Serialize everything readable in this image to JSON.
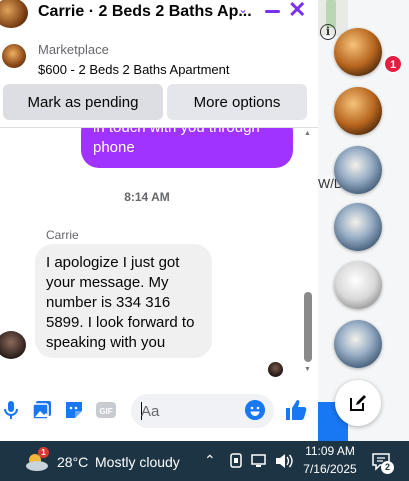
{
  "chat": {
    "title": "Carrie · 2 Beds 2 Baths Ap...",
    "marketplace_label": "Marketplace",
    "listing": "$600 - 2 Beds 2 Baths Apartment",
    "mark_pending": "Mark as pending",
    "more_options": "More options",
    "outgoing_partial": "in touch with you through phone",
    "timestamp": "8:14 AM",
    "sender": "Carrie",
    "incoming_message": "I apologize I just got your message. My number is 334 316 5899. I look forward to speaking with you",
    "composer_placeholder": "Aa"
  },
  "sidebar": {
    "info_icon": "i",
    "partial_text": "W/D",
    "unread_badge": "1"
  },
  "taskbar": {
    "weather_badge": "1",
    "temperature": "28°C",
    "condition": "Mostly cloudy",
    "time": "11:09 AM",
    "date": "7/16/2025",
    "notification_count": "2"
  },
  "colors": {
    "accent": "#7b2ff0",
    "outgoing_bubble": "#a033ff",
    "messenger_blue": "#1877f2",
    "taskbar": "#1d3444"
  }
}
